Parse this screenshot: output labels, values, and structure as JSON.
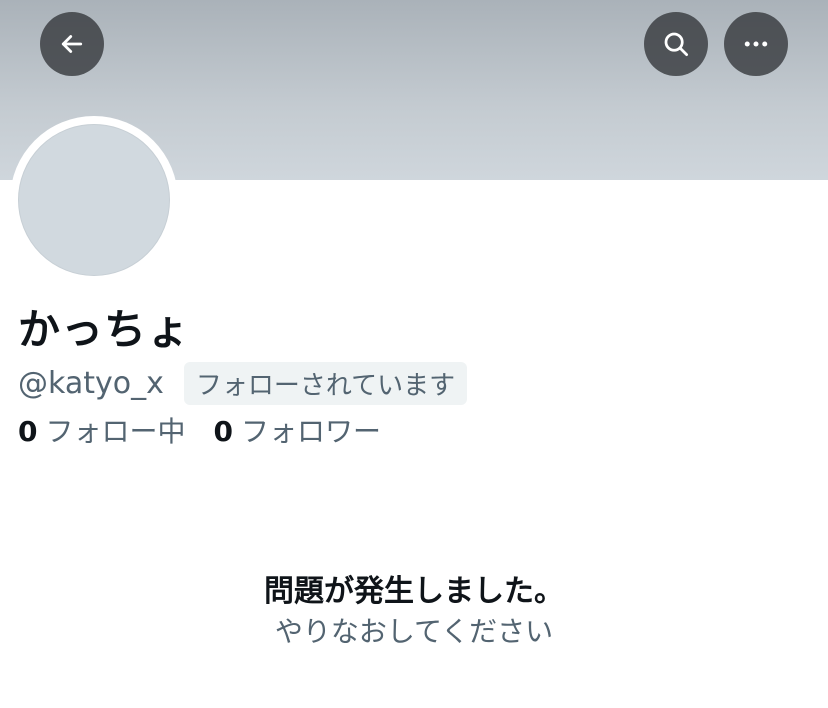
{
  "header": {
    "icons": {
      "back": "arrow-left-icon",
      "search": "search-icon",
      "more": "more-horizontal-icon"
    }
  },
  "profile": {
    "display_name": "かっちょ",
    "handle": "@katyo_x",
    "follows_you_badge": "フォローされています",
    "following_count": "0",
    "following_label": "フォロー中",
    "followers_count": "0",
    "followers_label": "フォロワー"
  },
  "error": {
    "title": "問題が発生しました。",
    "retry": "やりなおしてください"
  },
  "colors": {
    "primary_text": "#0f1419",
    "secondary_text": "#536471",
    "badge_bg": "#eff3f4",
    "avatar_placeholder": "#d1d9df",
    "header_button_bg": "#323538"
  }
}
